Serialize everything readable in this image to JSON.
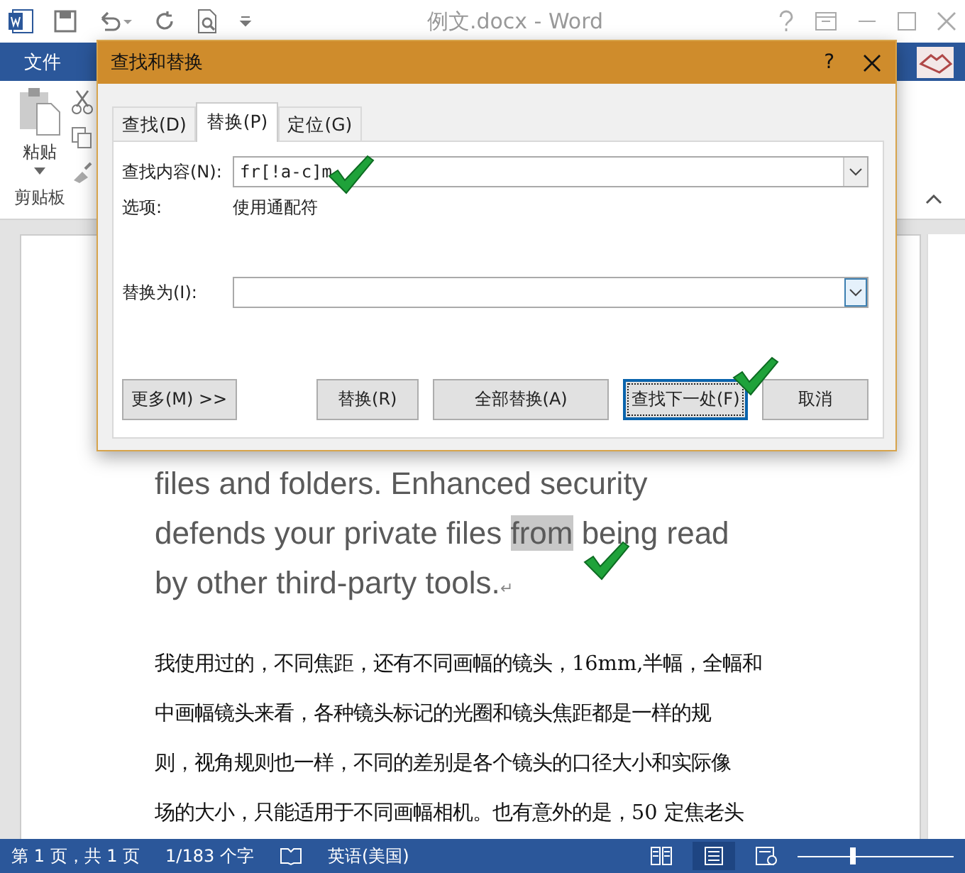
{
  "window": {
    "title": "例文.docx - Word"
  },
  "ribbon": {
    "file_tab": "文件",
    "paste": "粘贴",
    "group": "剪贴板"
  },
  "dialog": {
    "title": "查找和替换",
    "help": "?",
    "tabs": [
      {
        "label": "查找(D)",
        "selected": false
      },
      {
        "label": "替换(P)",
        "selected": true
      },
      {
        "label": "定位(G)",
        "selected": false
      }
    ],
    "find": {
      "label": "查找内容(N):",
      "value": "fr[!a-c]m"
    },
    "options": {
      "label": "选项:",
      "value": "使用通配符"
    },
    "replace": {
      "label": "替换为(I):"
    },
    "buttons": [
      {
        "label": "更多(M) >>",
        "focused": false
      },
      {
        "label": "替换(R)",
        "focused": false
      },
      {
        "label": "全部替换(A)",
        "focused": false
      },
      {
        "label": "查找下一处(F)",
        "focused": true
      },
      {
        "label": "取消",
        "focused": false
      }
    ]
  },
  "document": {
    "english_lines": [
      [
        {
          "text": "files and folders. Enhanced security",
          "highlighted": false
        }
      ],
      [
        {
          "text": "defends your private files ",
          "highlighted": false
        },
        {
          "text": "from",
          "highlighted": true
        },
        {
          "text": " being read",
          "highlighted": false
        }
      ],
      [
        {
          "text": "by other third-party tools.",
          "highlighted": false
        }
      ]
    ],
    "end_mark": "↵",
    "chinese_lines": [
      "我使用过的，不同焦距，还有不同画幅的镜头，16mm,半幅，全幅和",
      "中画幅镜头来看，各种镜头标记的光圈和镜头焦距都是一样的规",
      "则，视角规则也一样，不同的差别是各个镜头的口径大小和实际像",
      "场的大小，只能适用于不同画幅相机。也有意外的是，50 定焦老头"
    ]
  },
  "status_bar": {
    "page": "第 1 页，共 1 页",
    "words": "1/183 个字",
    "language": "英语(美国)",
    "zoom": {
      "level": 0.35
    }
  }
}
